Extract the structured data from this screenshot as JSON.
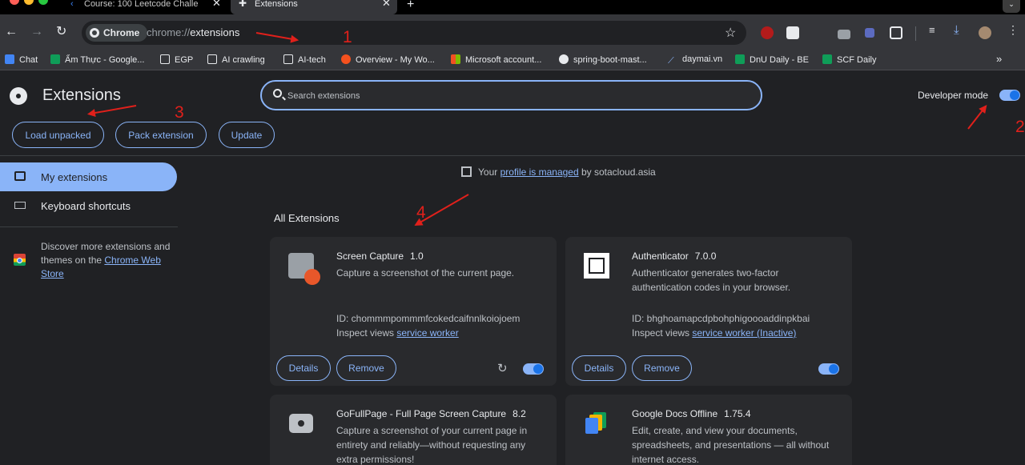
{
  "tabs": [
    {
      "title": "Course: 100 Leetcode Challe",
      "active": false
    },
    {
      "title": "Extensions",
      "active": true
    }
  ],
  "toolbar": {
    "chip_label": "Chrome",
    "url_scheme": "chrome://",
    "url_path": "extensions"
  },
  "bookmarks": [
    {
      "label": "Chat",
      "color": "#4285f4"
    },
    {
      "label": "Ẩm Thực - Google...",
      "color": "#0f9d58"
    },
    {
      "label": "EGP",
      "color": "folder"
    },
    {
      "label": "AI crawling",
      "color": "folder"
    },
    {
      "label": "AI-tech",
      "color": "folder"
    },
    {
      "label": "Overview - My Wo...",
      "color": "#f4511e"
    },
    {
      "label": "Microsoft account...",
      "color": "#f25022"
    },
    {
      "label": "spring-boot-mast...",
      "color": "#e8eaed"
    },
    {
      "label": "daymai.vn",
      "color": "#8ab4f8"
    },
    {
      "label": "DnU Daily - BE",
      "color": "#0f9d58"
    },
    {
      "label": "SCF Daily",
      "color": "#0f9d58"
    }
  ],
  "header": {
    "title": "Extensions",
    "search_placeholder": "Search extensions",
    "developer_mode_label": "Developer mode",
    "developer_mode_on": true,
    "buttons": {
      "load_unpacked": "Load unpacked",
      "pack_extension": "Pack extension",
      "update": "Update"
    }
  },
  "sidebar": {
    "items": [
      {
        "label": "My extensions",
        "active": true
      },
      {
        "label": "Keyboard shortcuts",
        "active": false
      }
    ],
    "discover_text": "Discover more extensions and themes on the ",
    "discover_link": "Chrome Web Store"
  },
  "main": {
    "managed_prefix": "Your ",
    "managed_link": "profile is managed",
    "managed_suffix": " by sotacloud.asia",
    "section_title": "All Extensions",
    "extensions": [
      {
        "name": "Screen Capture",
        "version": "1.0",
        "description": "Capture a screenshot of the current page.",
        "id_text": "ID: chommmpommmfcokedcaifnnlkoiojoem",
        "inspect_label": "Inspect views ",
        "inspect_link": "service worker",
        "details_label": "Details",
        "remove_label": "Remove",
        "enabled": true
      },
      {
        "name": "Authenticator",
        "version": "7.0.0",
        "description": "Authenticator generates two-factor authentication codes in your browser.",
        "id_text": "ID: bhghoamapcdpbohphigoooaddinpkbai",
        "inspect_label": "Inspect views ",
        "inspect_link": "service worker (Inactive)",
        "details_label": "Details",
        "remove_label": "Remove",
        "enabled": true
      },
      {
        "name": "GoFullPage - Full Page Screen Capture",
        "version": "8.2",
        "description": "Capture a screenshot of your current page in entirety and reliably—without requesting any extra permissions!"
      },
      {
        "name": "Google Docs Offline",
        "version": "1.75.4",
        "description": "Edit, create, and view your documents, spreadsheets, and presentations — all without internet access."
      }
    ]
  },
  "annotations": {
    "n1": "1",
    "n2": "2",
    "n3": "3",
    "n4": "4"
  }
}
